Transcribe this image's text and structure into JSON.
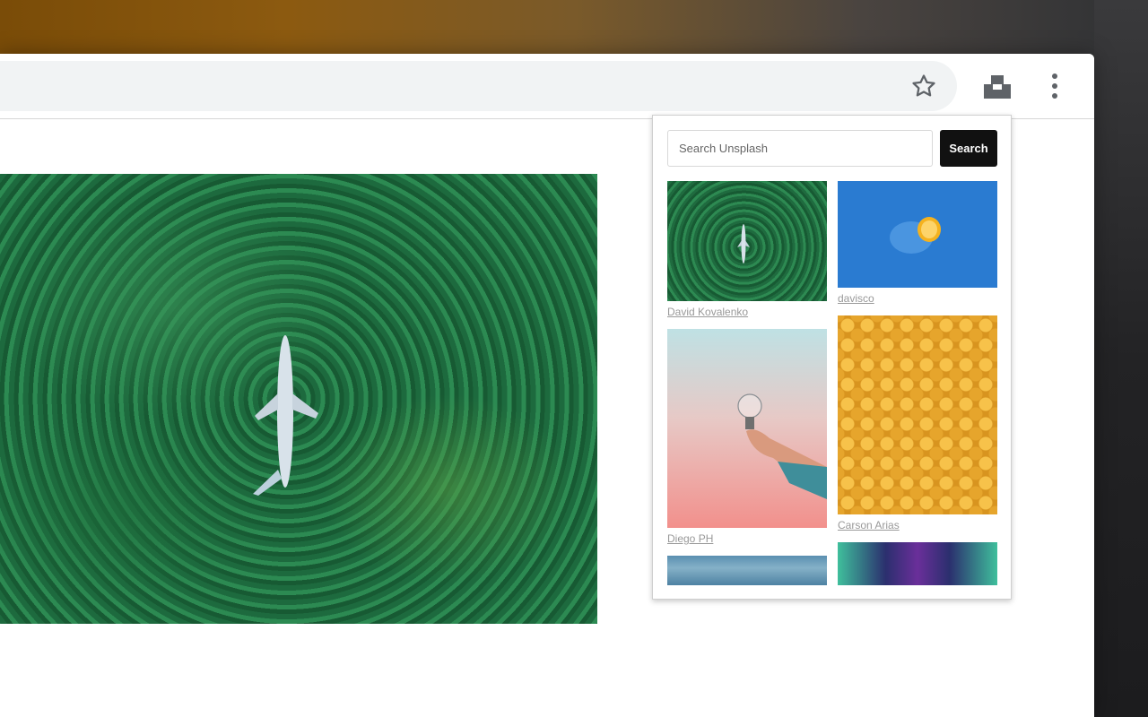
{
  "popup": {
    "search_placeholder": "Search Unsplash",
    "search_button": "Search",
    "left_column": [
      {
        "credit": "David Kovalenko",
        "photo": "forest-airplane-photo"
      },
      {
        "credit": "Diego PH",
        "photo": "lightbulb-in-hand-photo"
      },
      {
        "credit": "",
        "photo": "sea-photo"
      }
    ],
    "right_column": [
      {
        "credit": "davisco",
        "photo": "blue-lemon-photo"
      },
      {
        "credit": "Carson Arias",
        "photo": "yellow-heads-photo"
      },
      {
        "credit": "",
        "photo": "neon-tunnel-photo"
      }
    ]
  },
  "colors": {
    "search_button_bg": "#111111",
    "credit_text": "#999999",
    "omnibox_bg": "#f1f3f4"
  },
  "icons": [
    "star-icon",
    "unsplash-logo-icon",
    "more-vert-icon"
  ]
}
